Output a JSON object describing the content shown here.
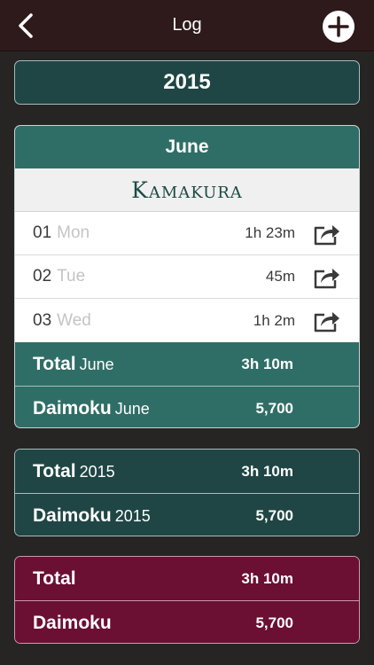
{
  "navbar": {
    "title": "Log",
    "back_icon": "chevron-left-icon",
    "add_icon": "plus-circle-icon"
  },
  "year": "2015",
  "month_card": {
    "month": "June",
    "place": "Kamakura",
    "entries": [
      {
        "day": "01",
        "dow": "Mon",
        "duration": "1h 23m"
      },
      {
        "day": "02",
        "dow": "Tue",
        "duration": "45m"
      },
      {
        "day": "03",
        "dow": "Wed",
        "duration": "1h 2m"
      }
    ],
    "total_label": "Total",
    "total_sub": "June",
    "total_value": "3h 10m",
    "daimoku_label": "Daimoku",
    "daimoku_sub": "June",
    "daimoku_value": "5,700"
  },
  "year_card": {
    "total_label": "Total",
    "total_sub": "2015",
    "total_value": "3h 10m",
    "daimoku_label": "Daimoku",
    "daimoku_sub": "2015",
    "daimoku_value": "5,700"
  },
  "all_card": {
    "total_label": "Total",
    "total_value": "3h 10m",
    "daimoku_label": "Daimoku",
    "daimoku_value": "5,700"
  },
  "colors": {
    "background": "#262523",
    "navbar": "#2e1a1a",
    "teal": "#2f6e66",
    "dark_teal": "#1f4644",
    "maroon": "#6b0f33"
  }
}
